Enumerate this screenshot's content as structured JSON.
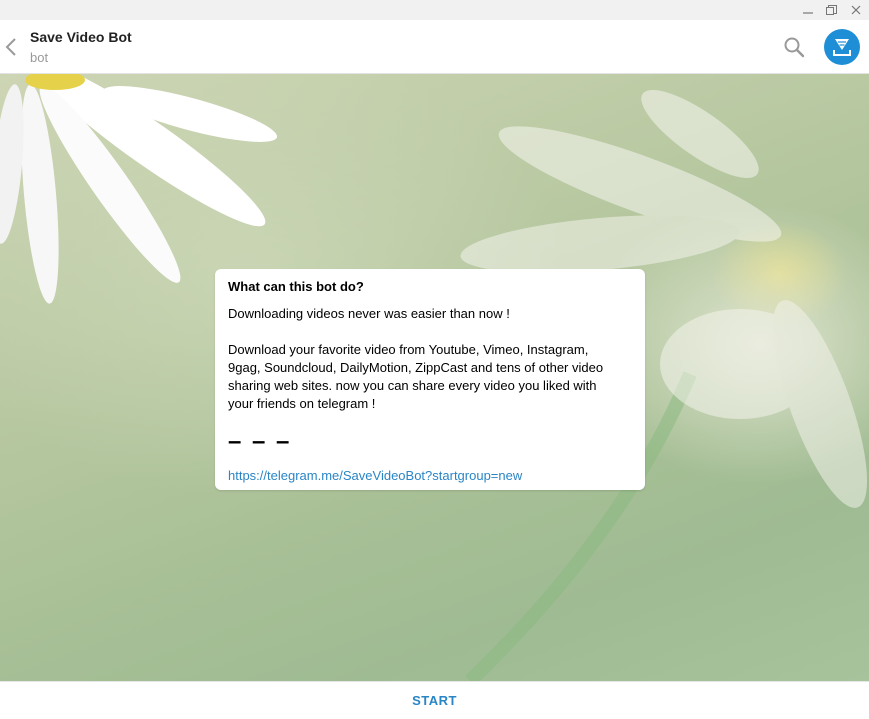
{
  "window": {
    "controls": [
      "minimize",
      "restore",
      "close"
    ]
  },
  "header": {
    "title": "Save Video Bot",
    "status": "bot",
    "icons": {
      "back": "chevron-left-icon",
      "search": "search-icon",
      "avatar": "download-icon"
    },
    "avatar_color": "#1e8fd6"
  },
  "message": {
    "title": "What can this bot do?",
    "line1": "Downloading videos never was easier than now !",
    "paragraph": "Download your favorite video from Youtube, Vimeo, Instagram,\n9gag, Soundcloud, DailyMotion, ZippCast and tens of other video\nsharing web sites. now you can share every video you liked with\nyour friends on telegram !",
    "dashes": "– – –",
    "link": "https://telegram.me/SaveVideoBot?startgroup=new"
  },
  "footer": {
    "start_label": "START"
  },
  "colors": {
    "accent": "#2a85c5"
  }
}
